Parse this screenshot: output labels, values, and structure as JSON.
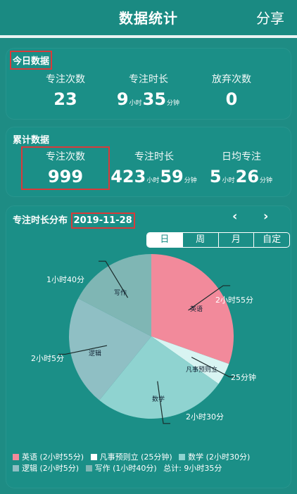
{
  "header": {
    "title": "数据统计",
    "share_label": "分享"
  },
  "today": {
    "heading": "今日数据",
    "focus_count_label": "专注次数",
    "focus_count": "23",
    "focus_time_label": "专注时长",
    "focus_hours": "9",
    "focus_minutes": "35",
    "giveup_label": "放弃次数",
    "giveup_count": "0",
    "unit_hour": "小时",
    "unit_minute": "分钟"
  },
  "total": {
    "heading": "累计数据",
    "focus_count_label": "专注次数",
    "focus_count": "999",
    "focus_time_label": "专注时长",
    "focus_hours": "423",
    "focus_minutes": "59",
    "daily_avg_label": "日均专注",
    "daily_hours": "5",
    "daily_minutes": "26",
    "unit_hour": "小时",
    "unit_minute": "分钟"
  },
  "distribution": {
    "heading": "专注时长分布",
    "date": "2019-11-28",
    "prev_icon": "chevron-left-icon",
    "next_icon": "chevron-right-icon",
    "tabs": [
      "日",
      "周",
      "月",
      "自定"
    ],
    "selected_tab": "日",
    "total_label": "总计: 9小时35分"
  },
  "chart_data": {
    "type": "pie",
    "unit": "minutes",
    "slices": [
      {
        "name": "英语",
        "value": 175,
        "label": "2小时55分",
        "legend": "英语 (2小时55分)",
        "color": "#f28a9b"
      },
      {
        "name": "凡事预则立",
        "value": 25,
        "label": "25分钟",
        "legend": "凡事预则立 (25分钟)",
        "color": "#d8f4f2"
      },
      {
        "name": "数学",
        "value": 150,
        "label": "2小时30分",
        "legend": "数学 (2小时30分)",
        "color": "#8fd3d0"
      },
      {
        "name": "逻辑",
        "value": 125,
        "label": "2小时5分",
        "legend": "逻辑 (2小时5分)",
        "color": "#8fbfc4"
      },
      {
        "name": "写作",
        "value": 100,
        "label": "1小时40分",
        "legend": "写作 (1小时40分)",
        "color": "#7fb6b4"
      }
    ]
  }
}
